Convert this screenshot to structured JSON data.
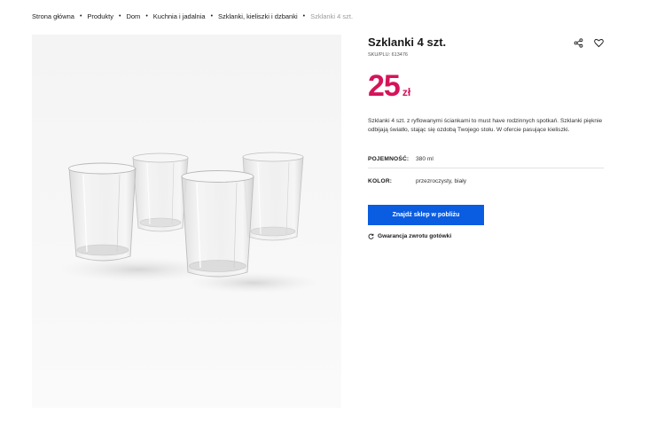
{
  "breadcrumb": {
    "items": [
      "Strona główna",
      "Produkty",
      "Dom",
      "Kuchnia i jadalnia",
      "Szklanki, kieliszki i dzbanki"
    ],
    "separator": "•",
    "current": "Szklanki 4 szt."
  },
  "gallery": {
    "image_alt": "Szklanki 4 szt.",
    "icon": "glasses-product-image"
  },
  "product": {
    "title": "Szklanki 4 szt.",
    "sku": "SKU/PLU: 613476",
    "price": {
      "value": "25",
      "currency": "zł",
      "color": "#d4145a"
    },
    "description": "Szklanki 4 szt. z ryflowanymi ściankami to must have rodzinnych spotkań. Szklanki pięknie odbijają światło, stając się ozdobą Twojego stołu. W ofercie pasujące kieliszki.",
    "specs": [
      {
        "label": "POJEMNOŚĆ:",
        "value": "380 ml"
      },
      {
        "label": "KOLOR:",
        "value": "przezroczysty, biały"
      }
    ]
  },
  "actions": {
    "share_icon": "share-icon",
    "wishlist_icon": "heart-icon"
  },
  "cta": {
    "label": "Znajdź sklep w pobliżu",
    "color": "#0a5ce0"
  },
  "guarantee": {
    "label": "Gwarancja zwrotu gotówki",
    "icon": "refresh-icon"
  }
}
